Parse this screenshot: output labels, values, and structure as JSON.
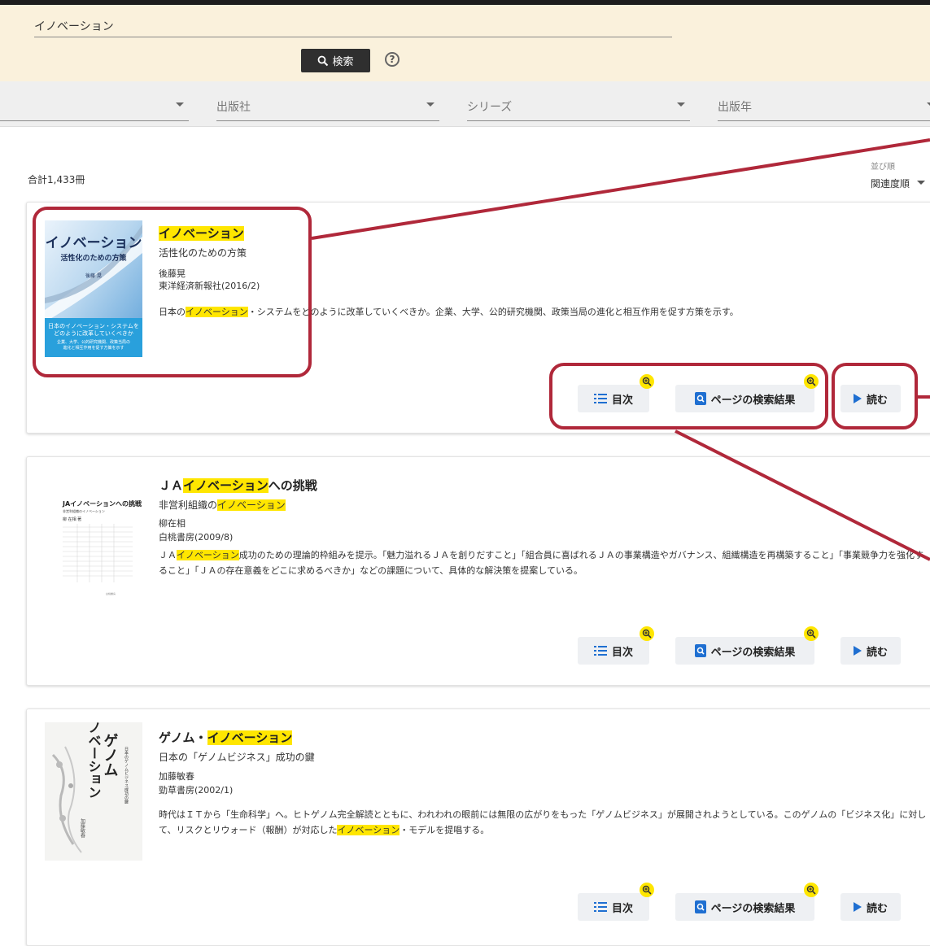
{
  "search": {
    "query": "イノベーション",
    "button_label": "検索",
    "help": "?"
  },
  "filters": [
    {
      "label": ""
    },
    {
      "label": "出版社"
    },
    {
      "label": "シリーズ"
    },
    {
      "label": "出版年"
    }
  ],
  "results": {
    "total": "合計1,433冊",
    "sort_label": "並び順",
    "sort_value": "関連度順"
  },
  "actions": {
    "toc": "目次",
    "page_results": "ページの検索結果",
    "read": "読む"
  },
  "books": [
    {
      "title_pre": "",
      "title_hl": "イノベーション",
      "title_post": "",
      "sub_pre": "活性化のための方策",
      "sub_hl": "",
      "sub_post": "",
      "author": "後藤晃",
      "publisher": "東洋経済新報社(2016/2)",
      "desc_pre": "日本の",
      "desc_hl": "イノベーション",
      "desc_post": "・システムをどのように改革していくべきか。企業、大学、公的研究機関、政策当局の進化と相互作用を促す方策を示す。",
      "cover": {
        "title": "イノベーション",
        "subtitle": "活性化のための方策",
        "author": "後藤 晃",
        "blurb1": "日本のイノベーション・システムを",
        "blurb2": "どのように改革していくべきか",
        "blurb3": "企業、大学、公的研究機関、政策当局の",
        "blurb4": "進化と相互作用を促す方策を示す"
      }
    },
    {
      "title_pre": "ＪＡ",
      "title_hl": "イノベーション",
      "title_post": "への挑戦",
      "sub_pre": "非営利組織の",
      "sub_hl": "イノベーション",
      "sub_post": "",
      "author": "柳在相",
      "publisher": "白桃書房(2009/8)",
      "desc_pre": "ＪＡ",
      "desc_hl": "イノベーション",
      "desc_post": "成功のための理論的枠組みを提示。「魅力溢れるＪＡを創りだすこと」「組合員に喜ばれるＪＡの事業構造やガバナンス、組織構造を再構築すること」「事業競争力を強化すること」「ＪＡの存在意義をどこに求めるべきか」などの課題について、具体的な解決策を提案している。",
      "cover": {
        "title": "JAイノベーションへの挑戦",
        "subtitle": "非営利組織のイノベーション",
        "author": "柳 在相 著",
        "publisher": "白桃書房"
      }
    },
    {
      "title_pre": "ゲノム・",
      "title_hl": "イノベーション",
      "title_post": "",
      "sub_pre": "日本の「ゲノムビジネス」成功の鍵",
      "sub_hl": "",
      "sub_post": "",
      "author": "加藤敏春",
      "publisher": "勁草書房(2002/1)",
      "desc_pre": "時代はＩＴから「生命科学」へ。ヒトゲノム完全解読とともに、われわれの眼前には無限の広がりをもった「ゲノムビジネス」が展開されようとしている。このゲノムの「ビジネス化」に対して、リスクとリウォード（報酬）が対応した",
      "desc_hl": "イノベーション",
      "desc_post": "・モデルを提唱する。",
      "cover": {
        "title1": "ゲノム",
        "title2": "イノベーション",
        "subtitle": "日本のゲノムビジネス成功の鍵",
        "author": "加藤敏春"
      }
    }
  ],
  "colors": {
    "highlight": "#ffe600",
    "annotation": "#b0283a",
    "header_bg": "#faf1dc"
  }
}
